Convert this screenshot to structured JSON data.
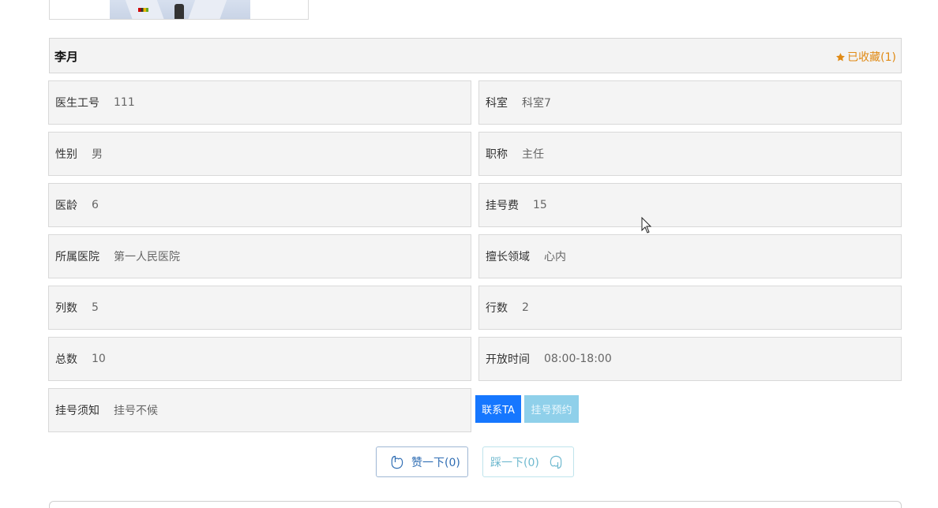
{
  "doctor": {
    "name": "李月",
    "favorite_label": "已收藏(1)"
  },
  "fields": [
    {
      "label": "医生工号",
      "value": "111"
    },
    {
      "label": "科室",
      "value": "科室7"
    },
    {
      "label": "性别",
      "value": "男"
    },
    {
      "label": "职称",
      "value": "主任"
    },
    {
      "label": "医龄",
      "value": "6"
    },
    {
      "label": "挂号费",
      "value": "15"
    },
    {
      "label": "所属医院",
      "value": "第一人民医院"
    },
    {
      "label": "擅长领域",
      "value": "心内"
    },
    {
      "label": "列数",
      "value": "5"
    },
    {
      "label": "行数",
      "value": "2"
    },
    {
      "label": "总数",
      "value": "10"
    },
    {
      "label": "开放时间",
      "value": "08:00-18:00"
    },
    {
      "label": "挂号须知",
      "value": "挂号不候"
    }
  ],
  "actions": {
    "contact_label": "联系TA",
    "book_label": "挂号预约"
  },
  "votes": {
    "like_label": "赞一下(0)",
    "dislike_label": "踩一下(0)"
  },
  "icons": {
    "favorite": "star-icon",
    "like": "thumbs-up-icon",
    "dislike": "thumbs-down-icon"
  },
  "colors": {
    "accent_orange": "#e08a14",
    "primary_blue": "#1677ff",
    "light_blue": "#8fd0ea"
  }
}
